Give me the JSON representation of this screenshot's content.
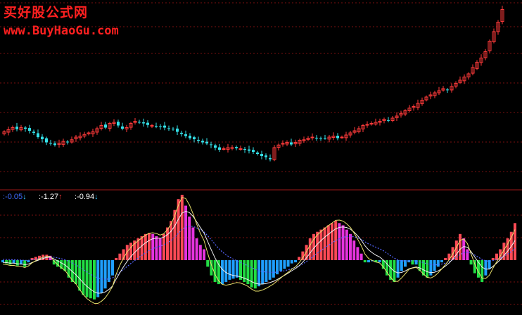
{
  "watermark": {
    "title": "买好股公式网",
    "url": "www.BuyHaoGu.com"
  },
  "readouts": [
    {
      "prefix": ":",
      "value": "-0.05",
      "arrow": "↓",
      "color": "#3f6bff",
      "arrow_color": "#33c8ff"
    },
    {
      "prefix": ":",
      "value": "-1.27",
      "arrow": "↑",
      "color": "#ffffff",
      "arrow_color": "#ff3a3a"
    },
    {
      "prefix": ":",
      "value": "-0.94",
      "arrow": "↓",
      "color": "#ffffff",
      "arrow_color": "#33c8ff"
    }
  ],
  "colors": {
    "background": "#000000",
    "grid": "#7a1010",
    "separator": "#a01818",
    "candle_up": "#ff3a3a",
    "candle_down": "#33e0e8",
    "hist_red": "#ff4a55",
    "hist_magenta": "#e633dd",
    "hist_green": "#22dd44",
    "hist_blue": "#1f9fff",
    "line_yellow": "#e8e06a",
    "line_white": "#f0f0f0",
    "line_blue": "#5566ff"
  },
  "chart_data": [
    {
      "type": "candlestick",
      "closes": [
        170,
        174,
        178,
        175,
        178,
        176,
        172,
        168,
        160,
        156,
        150,
        148,
        145,
        148,
        152,
        150,
        155,
        160,
        162,
        165,
        168,
        170,
        176,
        182,
        178,
        186,
        188,
        182,
        176,
        178,
        186,
        190,
        188,
        186,
        183,
        182,
        180,
        180,
        178,
        176,
        175,
        170,
        166,
        162,
        158,
        156,
        153,
        150,
        148,
        145,
        140,
        136,
        138,
        140,
        140,
        139,
        138,
        136,
        134,
        132,
        128,
        124,
        122,
        118,
        140,
        145,
        148,
        150,
        146,
        150,
        154,
        155,
        158,
        160,
        158,
        157,
        158,
        160,
        162,
        158,
        160,
        164,
        168,
        172,
        176,
        182,
        184,
        186,
        188,
        190,
        194,
        192,
        196,
        200,
        205,
        210,
        215,
        218,
        224,
        230,
        236,
        240,
        244,
        248,
        252,
        250,
        256,
        262,
        268,
        274,
        280,
        292,
        302,
        310,
        322,
        342,
        360,
        378,
        402
      ]
    },
    {
      "type": "bar",
      "histogram": [
        -2,
        -3,
        -4,
        -3,
        -5,
        -4,
        -6,
        -2,
        2,
        3,
        4,
        5,
        5,
        4,
        -4,
        -6,
        -8,
        -10,
        -16,
        -20,
        -22,
        -28,
        -32,
        -34,
        -35,
        -36,
        -34,
        -30,
        -26,
        -20,
        -14,
        2,
        6,
        10,
        14,
        16,
        18,
        20,
        22,
        24,
        25,
        24,
        22,
        20,
        24,
        30,
        36,
        46,
        56,
        60,
        50,
        40,
        30,
        20,
        14,
        10,
        -6,
        -14,
        -20,
        -22,
        -22,
        -20,
        -18,
        -17,
        -16,
        -18,
        -20,
        -22,
        -25,
        -26,
        -24,
        -22,
        -20,
        -18,
        -16,
        -13,
        -10,
        -8,
        -6,
        -3,
        -2,
        3,
        8,
        14,
        20,
        24,
        26,
        28,
        30,
        32,
        34,
        36,
        34,
        32,
        28,
        24,
        18,
        12,
        6,
        -2,
        -2,
        -1,
        -2,
        -2,
        -8,
        -14,
        -18,
        -20,
        -16,
        -10,
        -6,
        -2,
        -4,
        -4,
        -10,
        -14,
        -16,
        -14,
        -10,
        -6,
        -2,
        2,
        6,
        12,
        18,
        24,
        20,
        10,
        -4,
        -12,
        -16,
        -20,
        -14,
        -8,
        2,
        6,
        10,
        16,
        20,
        26,
        34
      ]
    }
  ]
}
